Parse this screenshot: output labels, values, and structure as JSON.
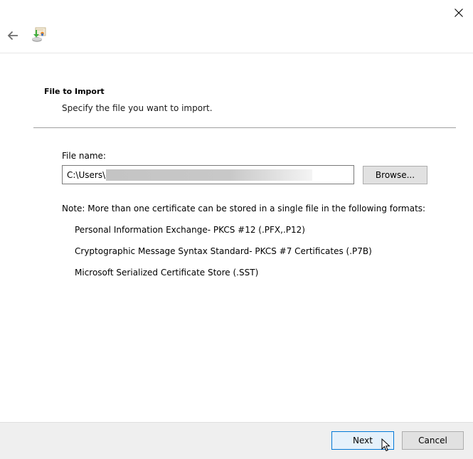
{
  "window": {
    "close_icon": "close-icon",
    "back_icon": "back-arrow-icon",
    "wizard_icon": "certificate-import-icon"
  },
  "page": {
    "title": "File to Import",
    "subtitle": "Specify the file you want to import."
  },
  "file": {
    "label": "File name:",
    "value": "C:\\Users\\",
    "value_redacted": true,
    "browse_label": "Browse..."
  },
  "note": {
    "text": "Note:  More than one certificate can be stored in a single file in the following formats:",
    "formats": [
      "Personal Information Exchange- PKCS #12 (.PFX,.P12)",
      "Cryptographic Message Syntax Standard- PKCS #7 Certificates (.P7B)",
      "Microsoft Serialized Certificate Store (.SST)"
    ]
  },
  "footer": {
    "next_label": "Next",
    "cancel_label": "Cancel"
  },
  "colors": {
    "accent": "#0078d7",
    "next_bg": "#e5f1fb",
    "footer_bg": "#efefef"
  }
}
